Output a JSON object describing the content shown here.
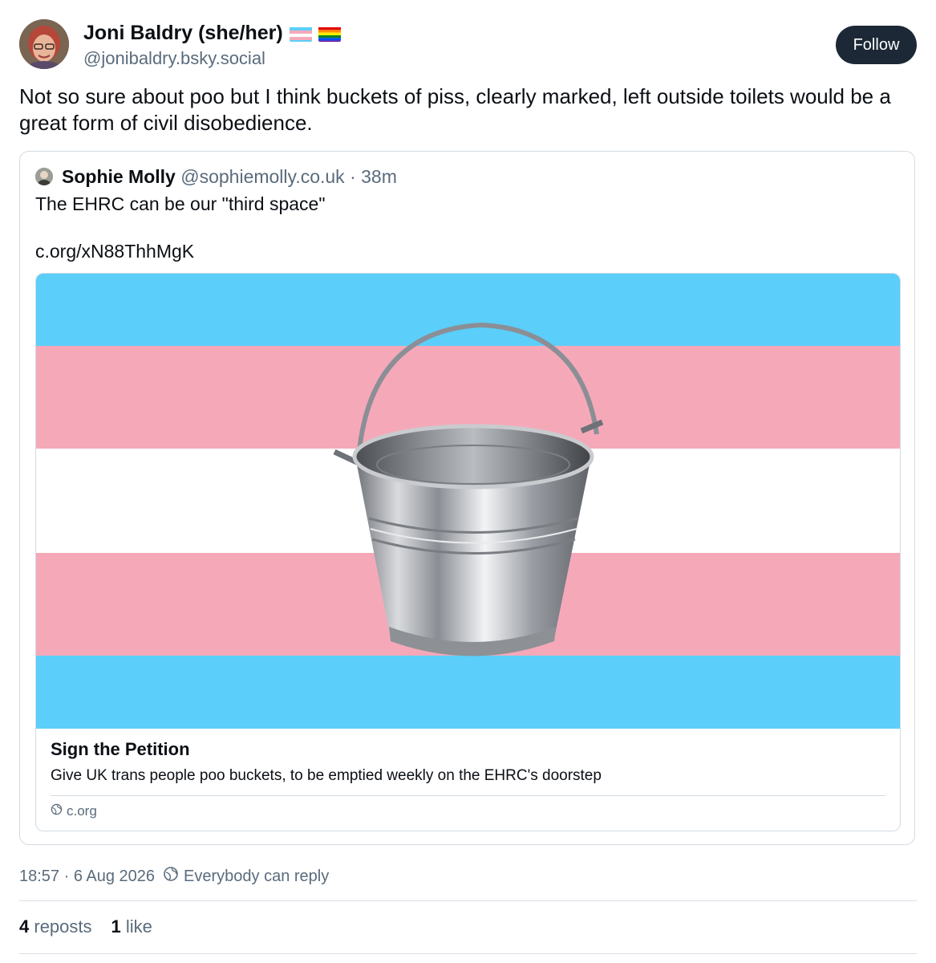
{
  "author": {
    "display_name": "Joni Baldry (she/her)",
    "handle": "@jonibaldry.bsky.social",
    "flags": [
      "transgender-flag",
      "rainbow-flag"
    ]
  },
  "follow_button": {
    "label": "Follow",
    "color": "#1c2836"
  },
  "post": {
    "text": "Not so sure about poo but I think buckets of piss, clearly marked, left outside toilets would be a great form of civil disobedience.",
    "timestamp": "18:57 · 6 Aug 2026",
    "reply_setting": "Everybody can reply",
    "reposts_count": "4",
    "reposts_label": "reposts",
    "likes_count": "1",
    "likes_label": "like"
  },
  "quoted_post": {
    "display_name": "Sophie Molly",
    "handle": "@sophiemolly.co.uk",
    "separator": "·",
    "age": "38m",
    "text": "The EHRC can be our \"third space\"",
    "link_text": "c.org/xN88ThhMgK",
    "link_card": {
      "title": "Sign the Petition",
      "description": "Give UK trans people poo buckets, to be emptied weekly on the EHRC's doorstep",
      "domain": "c.org",
      "image": "metal-bucket-on-transgender-flag"
    }
  },
  "colors": {
    "flag_blue": "#5bcefa",
    "flag_pink": "#f5a9b8",
    "flag_white": "#ffffff",
    "muted_text": "#5a6b7c",
    "border": "#d4dbe2"
  }
}
